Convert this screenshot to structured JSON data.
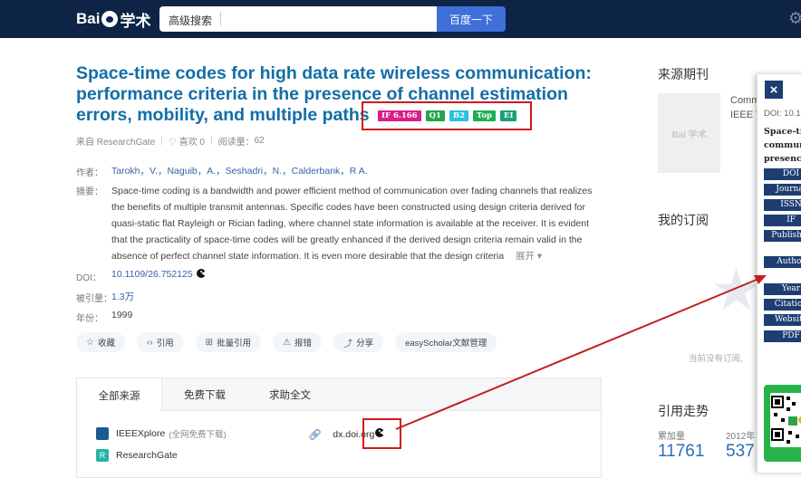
{
  "topbar": {
    "logo_text_left": "Bai",
    "logo_text_right": "学术",
    "search_placeholder": "高级搜索",
    "search_button": "百度一下"
  },
  "paper": {
    "title": "Space-time codes for high data rate wireless communication: performance criteria in the presence of channel estimation errors, mobility, and multiple paths",
    "badges": [
      "IF 6.166",
      "Q1",
      "B2",
      "Top",
      "EI"
    ],
    "source": "来自 ResearchGate",
    "likes": "♡ 喜欢 0",
    "reads_label": "阅读量：",
    "reads": "62",
    "authors_label": "作者：",
    "authors": "Tarokh，V.，Naguib，A.，Seshadri，N.，Calderbank，R A.",
    "abstract_label": "摘要：",
    "abstract": "Space-time coding is a bandwidth and power efficient method of communication over fading channels that realizes the benefits of multiple transmit antennas. Specific codes have been constructed using design criteria derived for quasi-static flat Rayleigh or Rician fading, where channel state information is available at the receiver. It is evident that the practicality of space-time codes will be greatly enhanced if the derived design criteria remain valid in the absence of perfect channel state information. It is even more desirable that the design criteria",
    "expand": "展开 ▾",
    "doi_label": "DOI：",
    "doi": "10.1109/26.752125",
    "cited_label": "被引量：",
    "cited": "1.3万",
    "year_label": "年份：",
    "year": "1999"
  },
  "actions": [
    {
      "icon": "☆",
      "label": "收藏"
    },
    {
      "icon": "‹›",
      "label": "引用"
    },
    {
      "icon": "⊞",
      "label": "批量引用"
    },
    {
      "icon": "⚠",
      "label": "报错"
    },
    {
      "icon": "⤴",
      "label": "分享"
    },
    {
      "icon": "",
      "label": "easyScholar文献管理"
    }
  ],
  "sources": {
    "tabs": [
      "全部来源",
      "免费下载",
      "求助全文"
    ],
    "items": [
      {
        "name": "IEEEXplore",
        "note": "(全网免费下载)"
      },
      {
        "name": "ResearchGate",
        "note": ""
      },
      {
        "name": "dx.doi.org",
        "note": ""
      }
    ]
  },
  "right": {
    "journal_heading": "来源期刊",
    "journal_line1": "Comm",
    "journal_line2": "IEEE T",
    "journal_img_text": "Bai 学术",
    "subscription_heading": "我的订阅",
    "subscription_empty": "当前没有订阅,",
    "trend_heading": "引用走势",
    "trend_total_label": "累加量",
    "trend_total": "11761",
    "trend_year_label": "2012年",
    "trend_year_value": "537"
  },
  "popup": {
    "close": "×",
    "doi": "DOI: 10.1",
    "title_lines": [
      "Space-tir",
      "commun",
      "presence"
    ],
    "fields": [
      "DOI",
      "Journal",
      "ISSN",
      "IF",
      "Publisher",
      "Author",
      "Year",
      "Citation",
      "Website",
      "PDF"
    ]
  },
  "colors": {
    "topbar": "#0e2446",
    "title": "#136ea6",
    "link": "#3464a7",
    "highlight": "#d11a1a",
    "popup_field": "#1e3e72"
  }
}
